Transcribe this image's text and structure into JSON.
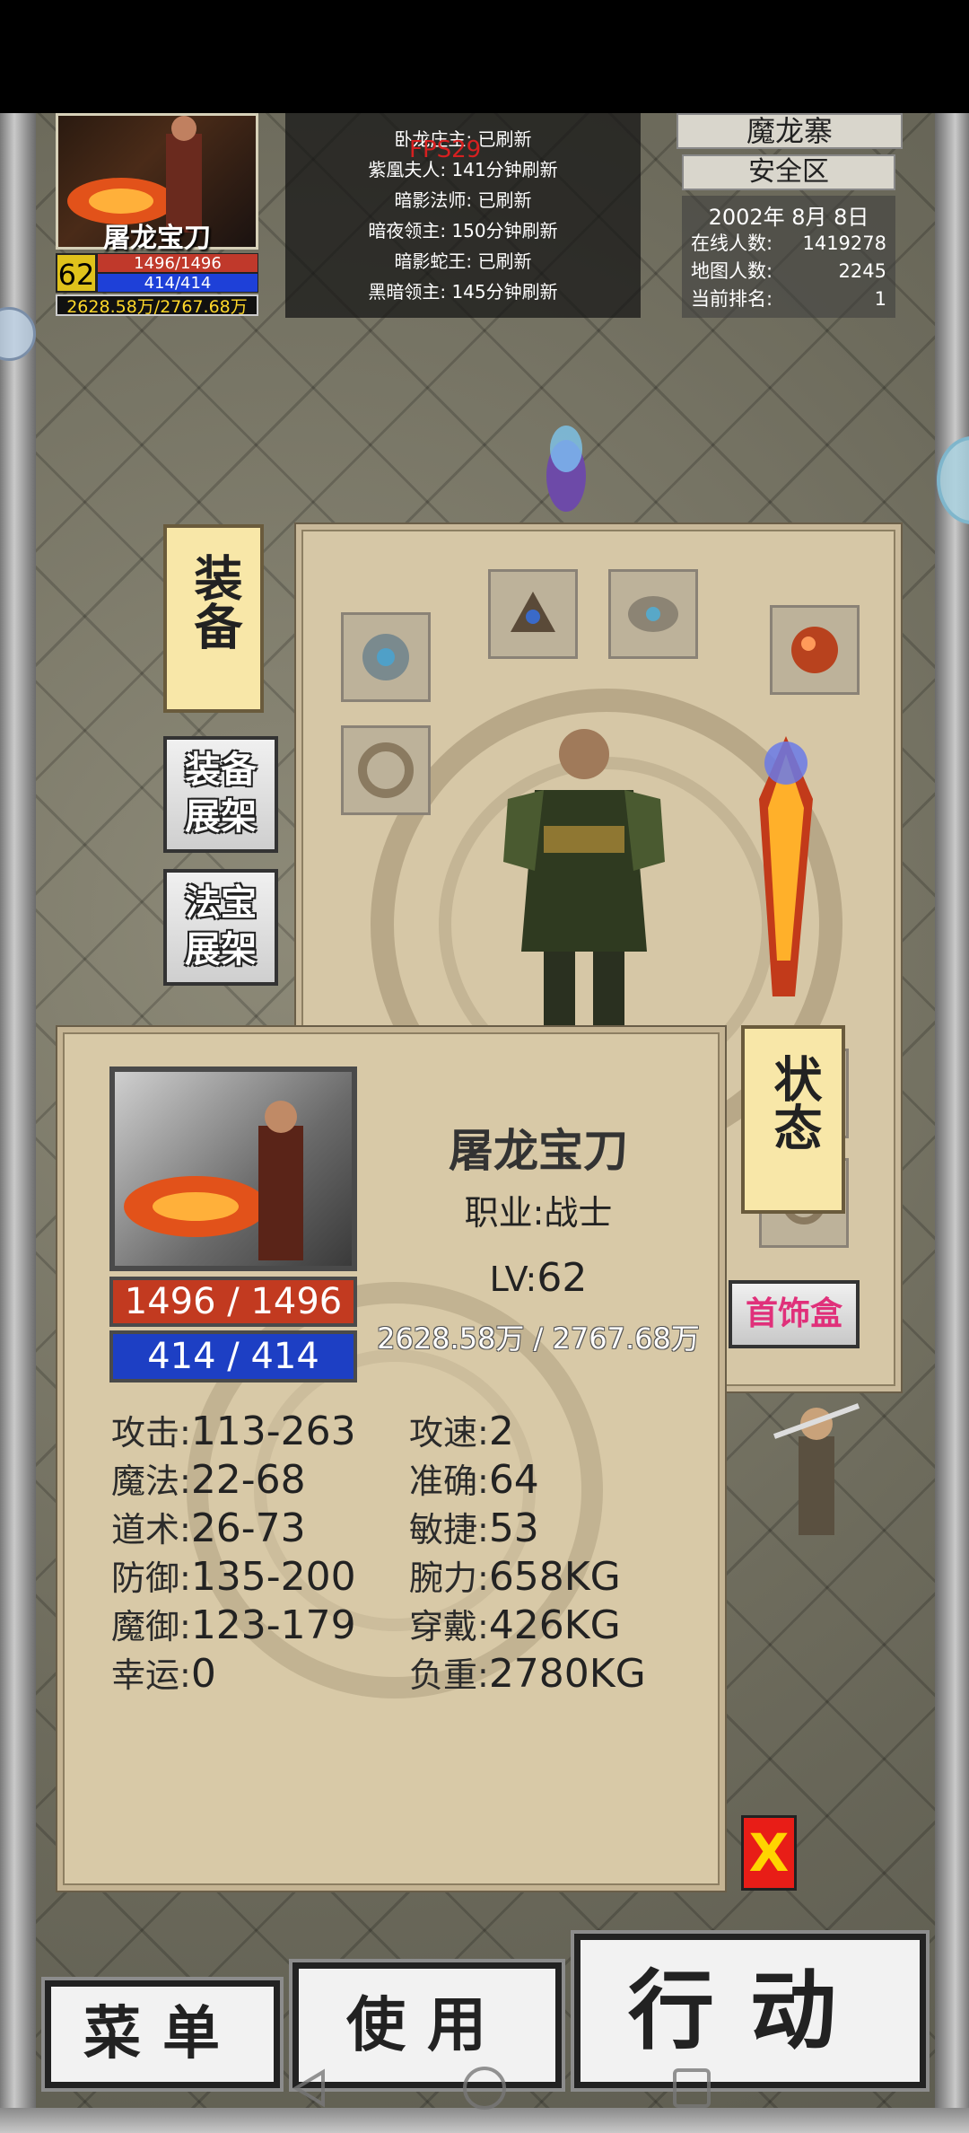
{
  "hud": {
    "name": "屠龙宝刀",
    "level": "62",
    "hp": "1496/1496",
    "mp": "414/414",
    "exp": "2628.58万/2767.68万"
  },
  "boss_list": {
    "fps": "FPS29",
    "rows": [
      "卧龙庄主: 已刷新",
      "紫凰夫人: 141分钟刷新",
      "暗影法师: 已刷新",
      "暗夜领主: 150分钟刷新",
      "暗影蛇王: 已刷新",
      "黑暗领主: 145分钟刷新"
    ]
  },
  "map": {
    "name": "魔龙寨",
    "zone": "安全区",
    "date": "2002年 8月 8日",
    "online_label": "在线人数:",
    "online_value": "1419278",
    "map_players_label": "地图人数:",
    "map_players_value": "2245",
    "rank_label": "当前排名:",
    "rank_value": "1"
  },
  "tabs": {
    "equip": "装备",
    "equip_rack_1": "装备",
    "equip_rack_2": "展架",
    "treasure_rack_1": "法宝",
    "treasure_rack_2": "展架",
    "status": "状态",
    "jewelry_box": "首饰盒"
  },
  "status": {
    "name": "屠龙宝刀",
    "job": "职业:战士",
    "lv_label": "LV:",
    "lv_value": "62",
    "hp": "1496 / 1496",
    "mp": "414 / 414",
    "exp": "2628.58万 / 2767.68万",
    "stats_left": [
      {
        "label": "攻击:",
        "value": "113-263"
      },
      {
        "label": "魔法:",
        "value": "22-68"
      },
      {
        "label": "道术:",
        "value": "26-73"
      },
      {
        "label": "防御:",
        "value": "135-200"
      },
      {
        "label": "魔御:",
        "value": "123-179"
      },
      {
        "label": "幸运:",
        "value": "0"
      }
    ],
    "stats_right": [
      {
        "label": "攻速:",
        "value": "2"
      },
      {
        "label": "准确:",
        "value": "64"
      },
      {
        "label": "敏捷:",
        "value": "53"
      },
      {
        "label": "腕力:",
        "value": "658KG"
      },
      {
        "label": "穿戴:",
        "value": "426KG"
      },
      {
        "label": "负重:",
        "value": "2780KG"
      }
    ],
    "close": "X"
  },
  "bottom": {
    "menu": "菜单",
    "use": "使用",
    "action": "行动"
  },
  "colors": {
    "hp_red": "#c23a20",
    "mp_blue": "#1d3fc4",
    "exp_gold": "#ffd82a",
    "close_red": "#e81d17"
  }
}
